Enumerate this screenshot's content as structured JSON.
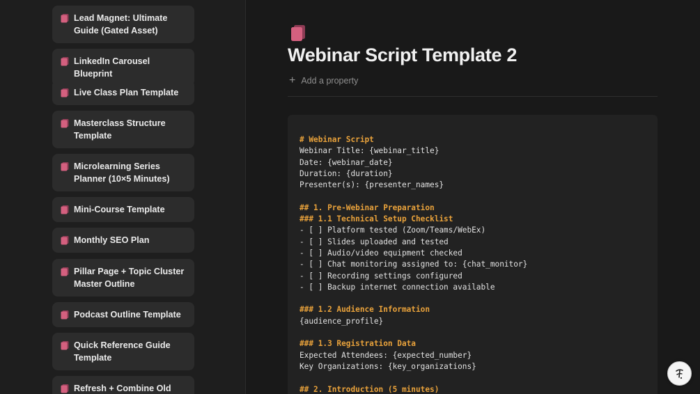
{
  "colors": {
    "accent_pink": "#d4607f",
    "heading": "#e9a23b"
  },
  "gallery": {
    "items": [
      {
        "label": "Lead Magnet: Ultimate Guide (Gated Asset)",
        "icon": "page-icon"
      },
      {
        "label": "LinkedIn Carousel Blueprint",
        "icon": "page-icon"
      },
      {
        "label": "Live Class Plan Template",
        "icon": "page-icon"
      },
      {
        "label": "Masterclass Structure Template",
        "icon": "page-icon"
      },
      {
        "label": "Microlearning Series Planner (10×5 Minutes)",
        "icon": "page-icon"
      },
      {
        "label": "Mini-Course Template",
        "icon": "page-icon"
      },
      {
        "label": "Monthly SEO Plan",
        "icon": "page-icon"
      },
      {
        "label": "Pillar Page + Topic Cluster Master Outline",
        "icon": "page-icon"
      },
      {
        "label": "Podcast Outline Template",
        "icon": "page-icon"
      },
      {
        "label": "Quick Reference Guide Template",
        "icon": "page-icon"
      },
      {
        "label": "Refresh + Combine Old Posts",
        "icon": "page-icon"
      }
    ]
  },
  "document": {
    "title": "Webinar Script Template 2",
    "add_property": "Add a property",
    "code_lines": [
      "# Webinar Script",
      "Webinar Title: {webinar_title}",
      "Date: {webinar_date}",
      "Duration: {duration}",
      "Presenter(s): {presenter_names}",
      "",
      "## 1. Pre-Webinar Preparation",
      "### 1.1 Technical Setup Checklist",
      "- [ ] Platform tested (Zoom/Teams/WebEx)",
      "- [ ] Slides uploaded and tested",
      "- [ ] Audio/video equipment checked",
      "- [ ] Chat monitoring assigned to: {chat_monitor}",
      "- [ ] Recording settings configured",
      "- [ ] Backup internet connection available",
      "",
      "### 1.2 Audience Information",
      "{audience_profile}",
      "",
      "### 1.3 Registration Data",
      "Expected Attendees: {expected_number}",
      "Key Organizations: {key_organizations}",
      "",
      "## 2. Introduction (5 minutes)"
    ]
  },
  "help": {
    "icon": "help-icon"
  }
}
